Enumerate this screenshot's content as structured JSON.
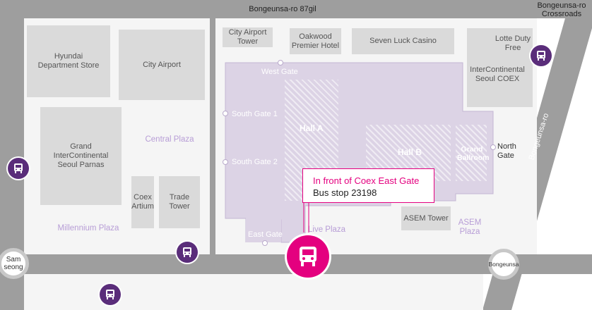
{
  "roads": {
    "top": "Bongeunsa-ro 87gil",
    "top_right": "Bongeunsa-ro\nCrossroads",
    "diagonal": "Bongeunsa-ro",
    "bottom_right_circle": "Bongeunsa",
    "bottom_left_circle": "Sam\nseong"
  },
  "buildings": {
    "hyundai": "Hyundai\nDepartment Store",
    "city_airport": "City Airport",
    "grand_ic_parnas": "Grand\nInterContinental\nSeoul Parnas",
    "coex_artium": "Coex\nArtium",
    "trade_tower": "Trade\nTower",
    "city_airport_tower": "City Airport\nTower",
    "oakwood": "Oakwood\nPremier Hotel",
    "seven_luck": "Seven Luck Casino",
    "lotte_duty_free": "Lotte Duty\nFree",
    "ic_seoul_coex": "InterContinental\nSeoul COEX",
    "asem_tower": "ASEM Tower"
  },
  "plazas": {
    "central": "Central Plaza",
    "millennium": "Millennium Plaza",
    "asem": "ASEM\nPlaza",
    "live": "Live Plaza"
  },
  "halls": {
    "hall_a": "Hall A",
    "hall_b": "Hall B",
    "grand_ballroom": "Grand\nBallroom"
  },
  "gates": {
    "west": "West Gate",
    "south1": "South Gate 1",
    "south2": "South Gate 2",
    "east": "East Gate",
    "north": "North\nGate"
  },
  "callout": {
    "line1": "In front of Coex East Gate",
    "line2": "Bus stop 23198"
  },
  "colors": {
    "road": "#9e9e9e",
    "coex": "#dcd3e5",
    "bus_icon": "#5a2d7a",
    "highlight": "#e4007f",
    "plaza_text": "#b79dd6"
  },
  "icons": {
    "bus_stop": "bus-icon",
    "highlighted_bus_stop": "bus-icon"
  }
}
